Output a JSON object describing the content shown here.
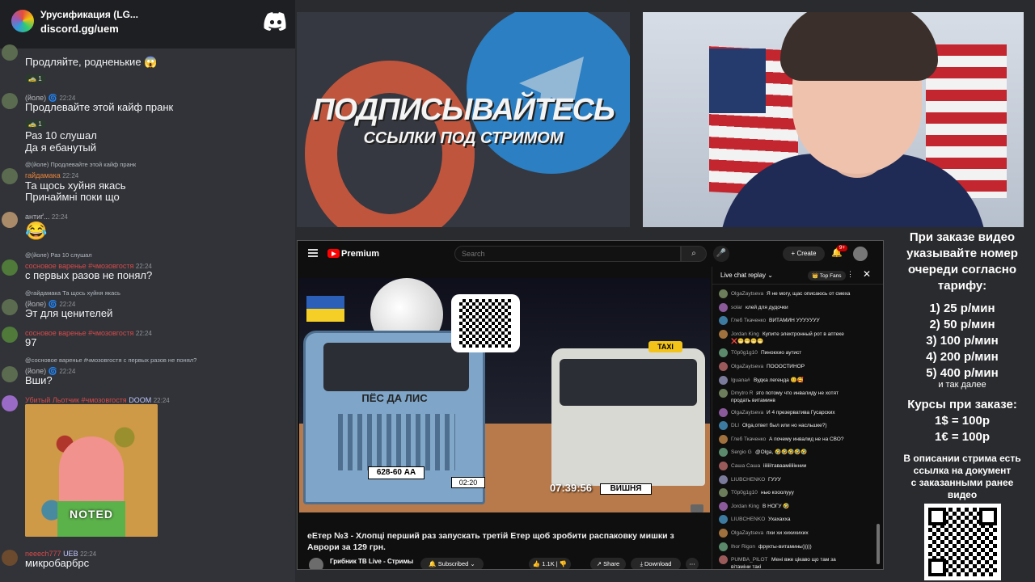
{
  "discord": {
    "server_title": "Урусификация (LG...",
    "invite": "discord.gg/uem",
    "messages": [
      {
        "text": "Продляйте, родненькие 😱",
        "reaction": "1"
      },
      {
        "author": "(йоле)",
        "time": "22:24",
        "text": "Продлевайте этой кайф пранк",
        "reaction": "1"
      },
      {
        "text": "Раз 10 слушал"
      },
      {
        "text": "Да я ебанутый"
      },
      {
        "reply": "@(йоле) Продлевайте этой кайф пранк",
        "author": "гайдамака",
        "time": "22:24",
        "text": "Та щось хуйня якась"
      },
      {
        "text": "Принаймні поки що"
      },
      {
        "author": "антиґ...",
        "time": "22:24",
        "text": "😂"
      },
      {
        "reply": "@(йоле) Раз 10 слушал",
        "author": "сосновое варенье #чмозовгостя",
        "time": "22:24",
        "text": "с первых разов не понял?"
      },
      {
        "reply": "@гайдамака Та щось хуйня якась",
        "author": "(йоле)",
        "time": "22:24",
        "text": "Эт для ценителей"
      },
      {
        "author": "сосновое варенье #чмозовгостя",
        "time": "22:24",
        "text": "97"
      },
      {
        "reply": "@сосновое варенье #чмозовгостя с первых разов не понял?",
        "author": "(йоле)",
        "time": "22:24",
        "text": "Вши?"
      },
      {
        "author": "Убитый Льотчик #чмозовгостя",
        "badge": "DOOM",
        "time": "22:24",
        "gif_caption": "NOTED"
      },
      {
        "author": "neeech777",
        "badge": "UEB",
        "time": "22:24",
        "text": "микробарбрс"
      }
    ]
  },
  "banner": {
    "line1": "ПОДПИСЫВАЙТЕСЬ",
    "line2": "ССЫЛКИ ПОД СТРИМОМ"
  },
  "youtube": {
    "brand": "Premium",
    "search_placeholder": "Search",
    "create_label": "Create",
    "notif_badge": "9+",
    "video_title": "еЕтер №3 - Хлопці перший раз запускать третій Етер щоб зробити распаковку мишки з Аврори за 129 грн.",
    "channel": "Грибник ТВ Live - Стримы",
    "subscribe_label": "Subscribed",
    "likes": "1.1K",
    "share_label": "Share",
    "download_label": "Download",
    "video_texts": {
      "truck_label": "ПЁС ДА ЛИС",
      "plate1": "628-60 АА",
      "plate2": "02:20",
      "timer": "07:39:56",
      "plate3": "ВИШНЯ",
      "taxi": "TAXI"
    },
    "chat": {
      "title": "Live chat replay",
      "top_fans": "Top Fans",
      "messages": [
        {
          "author": "OlgaZaytseva",
          "text": "Я не могу, щас описаюсь от смеха"
        },
        {
          "author": "solar",
          "text": "клей для дудочки"
        },
        {
          "author": "Глеб Ткаченко",
          "text": "ВИТАМИН УУУУУУУ"
        },
        {
          "author": "Jordan King",
          "text": "Купите электронный рот в аптеке",
          "text2": "❌😁😁😁😁"
        },
        {
          "author": "T0p0g1g10",
          "text": "Пинокхио аутист"
        },
        {
          "author": "OlgaZaytseva",
          "text": "ПОООСТИНОР"
        },
        {
          "author": "Iguana#",
          "text": "Вудка легенда 😊🥰"
        },
        {
          "author": "Dmytro R",
          "text": "это потому что инвалиду не хотят",
          "text2": "продать витаминв"
        },
        {
          "author": "OlgaZaytseva",
          "text": "И 4 презерватива Гусарских"
        },
        {
          "author": "DLI",
          "text": "Olga,ответ был или но насльшке?)"
        },
        {
          "author": "Глеб Ткаченко",
          "text": "А почему инвалид не на СВО?"
        },
        {
          "author": "Sergio G",
          "text": "@Olga, 🤣🤣🤣🤣🤣"
        },
        {
          "author": "Саша Саша",
          "text": "ііііііітавааміііііннии"
        },
        {
          "author": "LIUBCHENKO",
          "text": "ГУУУ"
        },
        {
          "author": "T0p0g1g10",
          "text": "нью кооолууу"
        },
        {
          "author": "Jordan King",
          "text": "В НОГУ 🤣"
        },
        {
          "author": "LIUBCHENKO",
          "text": "Ухахахха"
        },
        {
          "author": "OlgaZaytseva",
          "text": "пхи хи хихихихих"
        },
        {
          "author": "Ihor Rigon",
          "text": "фрукты-витамины)))))"
        },
        {
          "author": "PUMBA_PILOT",
          "text": "Мені вже цікаво що там за",
          "text2": "вітаміни такі"
        }
      ]
    }
  },
  "info": {
    "order_text": [
      "При заказе видео",
      "указывайте номер",
      "очереди согласно",
      "тарифу:"
    ],
    "tariffs": [
      "1) 25 р/мин",
      "2) 50 р/мин",
      "3) 100 р/мин",
      "4) 200 р/мин",
      "5) 400 р/мин"
    ],
    "etc": "и так далее",
    "rates_title": "Курсы при заказе:",
    "rates": [
      "1$ = 100р",
      "1€ = 100р"
    ],
    "desc": [
      "В описании стрима есть",
      "ссылка на документ",
      "с заказанными ранее",
      "видео"
    ]
  }
}
